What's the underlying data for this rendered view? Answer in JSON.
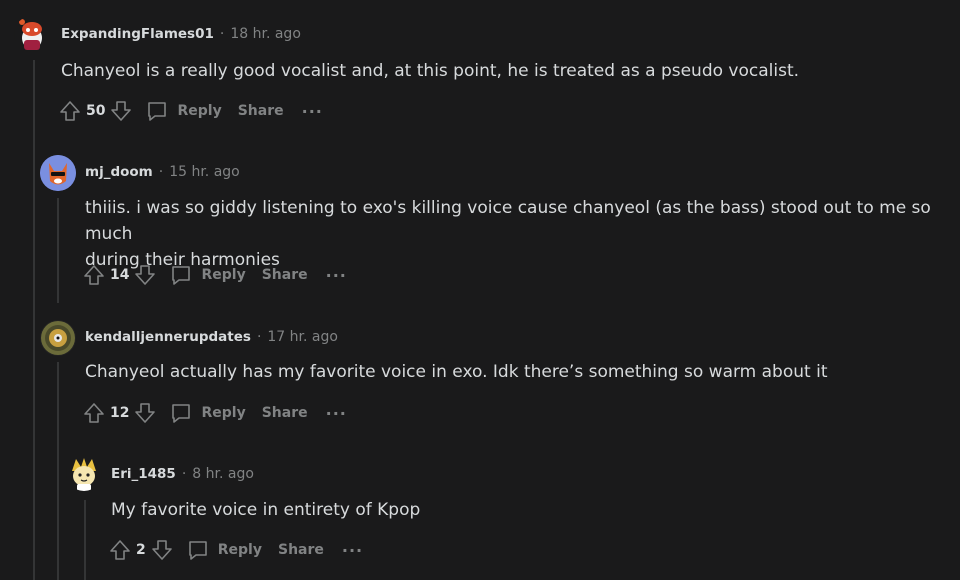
{
  "comments": [
    {
      "author": "ExpandingFlames01",
      "time": "18 hr. ago",
      "body": "Chanyeol is a really good vocalist and, at this point, he is treated as a pseudo vocalist.",
      "score": "50",
      "reply_label": "Reply",
      "share_label": "Share",
      "more_label": "···"
    },
    {
      "author": "mj_doom",
      "time": "15 hr. ago",
      "body_line1": "thiiis. i was so giddy listening to exo's killing voice cause chanyeol (as the bass) stood out to me so much",
      "body_line2": "during their harmonies",
      "score": "14",
      "reply_label": "Reply",
      "share_label": "Share",
      "more_label": "···"
    },
    {
      "author": "kendalljennerupdates",
      "time": "17 hr. ago",
      "body": "Chanyeol actually has my favorite voice in exo. Idk there’s something so warm about it",
      "score": "12",
      "reply_label": "Reply",
      "share_label": "Share",
      "more_label": "···"
    },
    {
      "author": "Eri_1485",
      "time": "8 hr. ago",
      "body": "My favorite voice in entirety of Kpop",
      "score": "2",
      "reply_label": "Reply",
      "share_label": "Share",
      "more_label": "···"
    }
  ],
  "separator": "·",
  "colors": {
    "background": "#1a1a1b",
    "text": "#d7dadc",
    "muted": "#818384",
    "thread_line": "#343536"
  }
}
